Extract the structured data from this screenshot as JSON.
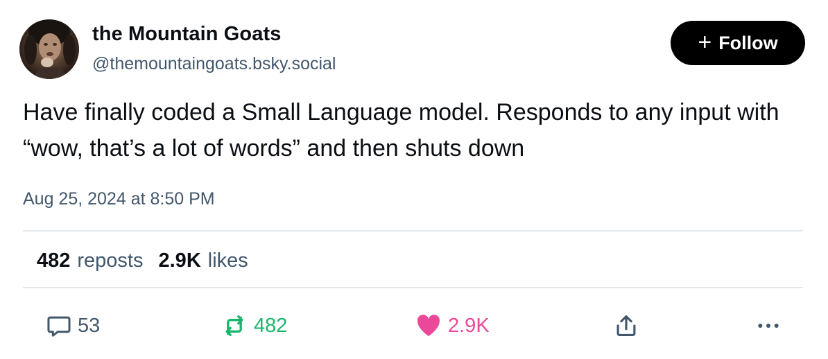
{
  "author": {
    "display_name": "the Mountain Goats",
    "handle": "@themountaingoats.bsky.social"
  },
  "follow_button": {
    "label": "Follow",
    "icon": "plus-icon"
  },
  "post": {
    "text": "Have finally coded a Small Language model. Responds to any input with “wow, that’s a lot of words” and then shuts down",
    "timestamp": "Aug 25, 2024 at 8:50 PM"
  },
  "stats": {
    "reposts_count": "482",
    "reposts_label": "reposts",
    "likes_count": "2.9K",
    "likes_label": "likes"
  },
  "actions": {
    "reply": {
      "icon": "reply-bubble-icon",
      "count": "53"
    },
    "repost": {
      "icon": "repost-icon",
      "count": "482",
      "color": "#19b56b"
    },
    "like": {
      "icon": "heart-icon",
      "count": "2.9K",
      "color": "#ec4899"
    },
    "share": {
      "icon": "share-icon"
    },
    "more": {
      "icon": "more-dots-icon"
    }
  }
}
